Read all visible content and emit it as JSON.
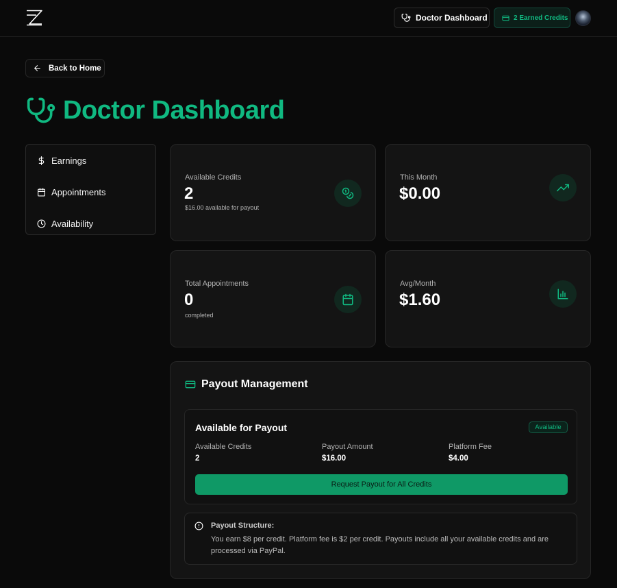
{
  "colors": {
    "background": "#0a0a0a",
    "card": "#141414",
    "accent": "#10b981",
    "button": "#0f9966",
    "border": "#262626"
  },
  "nav": {
    "logo_icon": "z-logo-icon",
    "dashboard_label": "Doctor Dashboard",
    "dashboard_icon": "stethoscope-icon",
    "credits_label": "2 Earned Credits",
    "credits_icon": "credit-card-icon",
    "avatar_icon": "user-avatar"
  },
  "back": {
    "label": "Back to Home",
    "icon": "arrow-left-icon"
  },
  "page": {
    "title": "Doctor Dashboard",
    "title_icon": "stethoscope-icon"
  },
  "sidebar": {
    "items": [
      {
        "label": "Earnings",
        "icon": "dollar-icon"
      },
      {
        "label": "Appointments",
        "icon": "calendar-icon"
      },
      {
        "label": "Availability",
        "icon": "clock-icon"
      }
    ]
  },
  "stats": {
    "available_credits": {
      "label": "Available Credits",
      "value": "2",
      "sub": "$16.00 available for payout",
      "icon": "coins-icon"
    },
    "this_month": {
      "label": "This Month",
      "value": "$0.00",
      "icon": "trending-up-icon"
    },
    "total_appointments": {
      "label": "Total Appointments",
      "value": "0",
      "sub": "completed",
      "icon": "calendar-icon"
    },
    "avg_month": {
      "label": "Avg/Month",
      "value": "$1.60",
      "icon": "bar-chart-icon"
    }
  },
  "payout": {
    "title": "Payout Management",
    "title_icon": "credit-card-icon",
    "available": {
      "title": "Available for Payout",
      "badge": "Available",
      "metrics": [
        {
          "label": "Available Credits",
          "value": "2"
        },
        {
          "label": "Payout Amount",
          "value": "$16.00"
        },
        {
          "label": "Platform Fee",
          "value": "$4.00"
        }
      ],
      "button_label": "Request Payout for All Credits"
    },
    "structure": {
      "title": "Payout Structure:",
      "text": "You earn $8 per credit. Platform fee is $2 per credit. Payouts include all your available credits and are processed via PayPal.",
      "icon": "alert-circle-icon"
    }
  }
}
